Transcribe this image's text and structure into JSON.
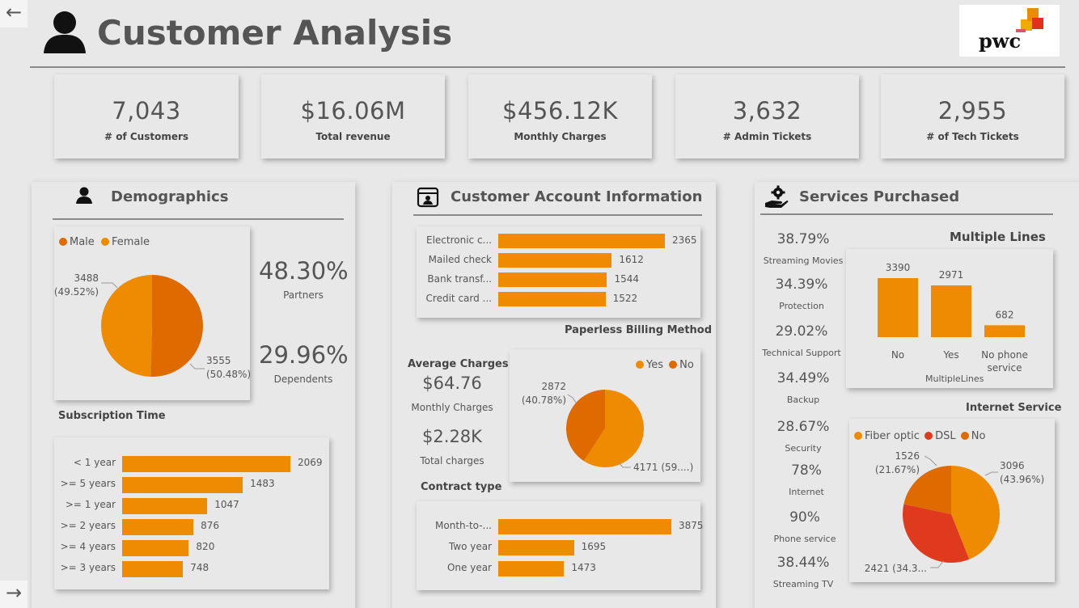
{
  "header": {
    "title": "Customer Analysis",
    "logo_text": "pwc"
  },
  "kpis": [
    {
      "value": "7,043",
      "label": "# of Customers"
    },
    {
      "value": "$16.06M",
      "label": "Total revenue"
    },
    {
      "value": "$456.12K",
      "label": "Monthly Charges"
    },
    {
      "value": "3,632",
      "label": "# Admin Tickets"
    },
    {
      "value": "2,955",
      "label": "#  of Tech Tickets"
    }
  ],
  "demographics": {
    "title": "Demographics",
    "legend": [
      "Male",
      "Female"
    ],
    "gender_pie": {
      "type": "pie",
      "slices": [
        {
          "name": "Male",
          "value": 3555,
          "label": "3555",
          "pct": "(50.48%)",
          "color": "#de6a00"
        },
        {
          "name": "Female",
          "value": 3488,
          "label": "3488",
          "pct": "(49.52%)",
          "color": "#ee8b00"
        }
      ]
    },
    "partners_pct": "48.30%",
    "partners_label": "Partners",
    "dependents_pct": "29.96%",
    "dependents_label": "Dependents",
    "subscription_title": "Subscription Time"
  },
  "account": {
    "title": "Customer Account Information",
    "paperless_title": "Paperless Billing Method",
    "avg_title": "Average Charges",
    "avg_monthly_value": "$64.76",
    "avg_monthly_label": "Monthly Charges",
    "total_charges_value": "$2.28K",
    "total_charges_label": "Total charges",
    "contract_title": "Contract type",
    "paperless_legend": [
      "Yes",
      "No"
    ]
  },
  "services": {
    "title": "Services Purchased",
    "stats": [
      {
        "pct": "38.79%",
        "label": "Streaming Movies"
      },
      {
        "pct": "34.39%",
        "label": "Protection"
      },
      {
        "pct": "29.02%",
        "label": "Technical Support"
      },
      {
        "pct": "34.49%",
        "label": "Backup"
      },
      {
        "pct": "28.67%",
        "label": "Security"
      },
      {
        "pct": "78%",
        "label": "Internet"
      },
      {
        "pct": "90%",
        "label": "Phone service"
      },
      {
        "pct": "38.44%",
        "label": "Streaming TV"
      }
    ],
    "multiple_lines_title": "Multiple Lines",
    "multiple_lines_axis": "MultipleLines",
    "internet_title": "Internet Service",
    "internet_legend": [
      "Fiber optic",
      "DSL",
      "No"
    ]
  },
  "nav": {
    "back": "←",
    "forward": "→"
  },
  "chart_data": [
    {
      "id": "gender",
      "type": "pie",
      "categories": [
        "Male",
        "Female"
      ],
      "values": [
        3555,
        3488
      ],
      "labels": [
        "3555\n(50.48%)",
        "3488\n(49.52%)"
      ]
    },
    {
      "id": "subscription",
      "type": "bar",
      "orientation": "horizontal",
      "categories": [
        "< 1 year",
        ">= 5 years",
        ">= 1 year",
        ">= 2 years",
        ">= 4 years",
        ">= 3 years"
      ],
      "values": [
        2069,
        1483,
        1047,
        876,
        820,
        748
      ]
    },
    {
      "id": "payment_method",
      "type": "bar",
      "orientation": "horizontal",
      "categories": [
        "Electronic c...",
        "Mailed check",
        "Bank transf...",
        "Credit card ..."
      ],
      "values": [
        2365,
        1612,
        1544,
        1522
      ]
    },
    {
      "id": "paperless",
      "type": "pie",
      "categories": [
        "Yes",
        "No"
      ],
      "values": [
        4171,
        2872
      ],
      "labels": [
        "4171 (59....)",
        "2872\n(40.78%)"
      ]
    },
    {
      "id": "contract",
      "type": "bar",
      "orientation": "horizontal",
      "categories": [
        "Month-to-...",
        "Two year",
        "One year"
      ],
      "values": [
        3875,
        1695,
        1473
      ]
    },
    {
      "id": "multiple_lines",
      "type": "bar",
      "categories": [
        "No",
        "Yes",
        "No phone service"
      ],
      "values": [
        3390,
        2971,
        682
      ],
      "xlabel": "MultipleLines"
    },
    {
      "id": "internet_service",
      "type": "pie",
      "categories": [
        "Fiber optic",
        "DSL",
        "No"
      ],
      "values": [
        3096,
        2421,
        1526
      ],
      "labels": [
        "3096\n(43.96%)",
        "2421 (34.3...)",
        "1526\n(21.67%)"
      ]
    }
  ]
}
